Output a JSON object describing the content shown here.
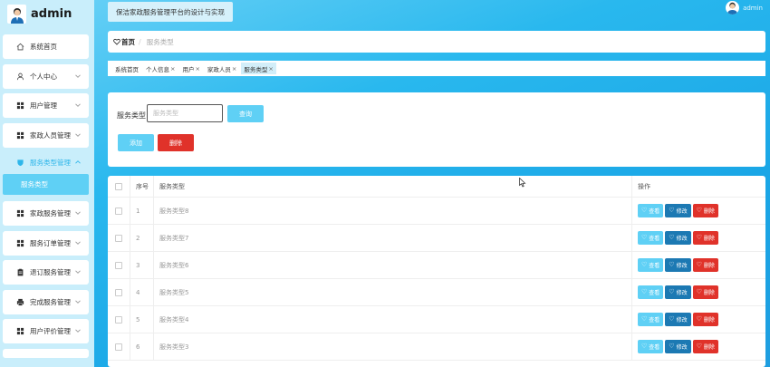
{
  "sidebar": {
    "brand": "admin",
    "items": [
      {
        "label": "系统首页",
        "icon": "home-icon",
        "chevron": false
      },
      {
        "label": "个人中心",
        "icon": "user-icon",
        "chevron": true
      },
      {
        "label": "用户管理",
        "icon": "grid-icon",
        "chevron": true
      },
      {
        "label": "家政人员管理",
        "icon": "grid-icon",
        "chevron": true
      },
      {
        "label": "服务类型管理",
        "icon": "shield-icon",
        "chevron": true,
        "expanded": true
      },
      {
        "label": "家政服务管理",
        "icon": "grid-icon",
        "chevron": true
      },
      {
        "label": "服务订单管理",
        "icon": "grid-icon",
        "chevron": true
      },
      {
        "label": "退订服务管理",
        "icon": "clipboard-icon",
        "chevron": true
      },
      {
        "label": "完成服务管理",
        "icon": "printer-icon",
        "chevron": true
      },
      {
        "label": "用户评价管理",
        "icon": "grid-icon",
        "chevron": true
      }
    ],
    "submenu": {
      "label": "服务类型"
    }
  },
  "header": {
    "project_title": "保洁家政服务管理平台的设计与实现",
    "username": "admin"
  },
  "breadcrumb": {
    "home": "首页",
    "current": "服务类型"
  },
  "tags": [
    {
      "label": "系统首页",
      "closable": false,
      "active": false
    },
    {
      "label": "个人信息",
      "closable": true,
      "active": false
    },
    {
      "label": "用户",
      "closable": true,
      "active": false
    },
    {
      "label": "家政人员",
      "closable": true,
      "active": false
    },
    {
      "label": "服务类型",
      "closable": true,
      "active": true
    }
  ],
  "tag_close": "×",
  "search": {
    "label": "服务类型",
    "placeholder": "服务类型",
    "query_button": "查询",
    "add_button": "添加",
    "delete_button": "删除"
  },
  "table": {
    "headers": {
      "index": "序号",
      "name": "服务类型",
      "ops": "操作"
    },
    "rows": [
      {
        "index": "1",
        "name": "服务类型8"
      },
      {
        "index": "2",
        "name": "服务类型7"
      },
      {
        "index": "3",
        "name": "服务类型6"
      },
      {
        "index": "4",
        "name": "服务类型5"
      },
      {
        "index": "5",
        "name": "服务类型4"
      },
      {
        "index": "6",
        "name": "服务类型3"
      }
    ],
    "ops": {
      "view": "查看",
      "edit": "修改",
      "delete": "删除"
    }
  },
  "colors": {
    "accent": "#5fd0f5",
    "edit": "#1c79b3",
    "danger": "#e0322a",
    "sidebar_bg": "#c9eefb"
  }
}
